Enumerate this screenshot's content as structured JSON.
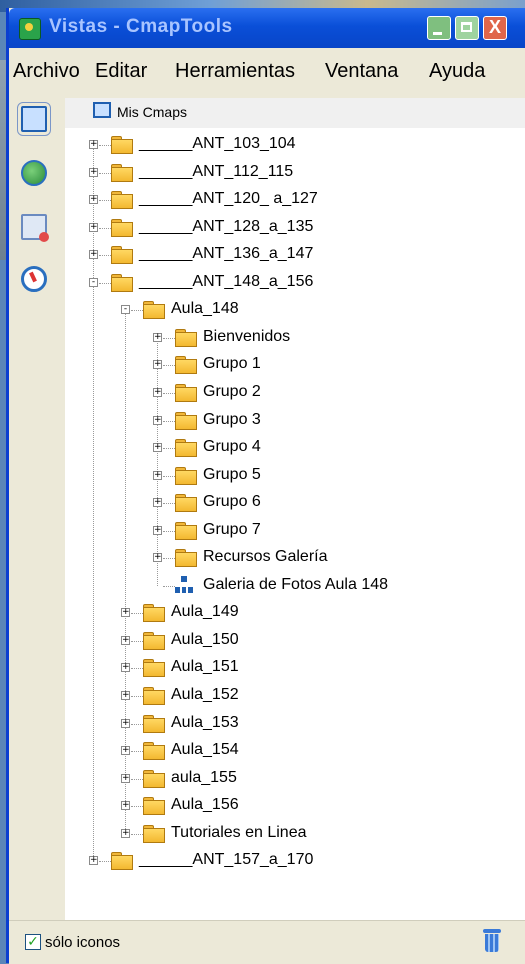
{
  "window": {
    "title": "Vistas - CmapTools",
    "close_glyph": "X"
  },
  "menu": [
    "Archivo",
    "Editar",
    "Herramientas",
    "Ventana",
    "Ayuda"
  ],
  "sidebar": [
    "monitor-icon",
    "globe-icon",
    "history-icon",
    "compass-icon"
  ],
  "tree": {
    "root": "Mis Cmaps",
    "items": [
      "______ANT_103_104",
      "______ANT_112_115",
      "______ANT_120_ a_127",
      "______ANT_128_a_135",
      "______ANT_136_a_147",
      "______ANT_148_a_156",
      "Aula_148",
      "Bienvenidos",
      "Grupo 1",
      "Grupo 2",
      "Grupo 3",
      "Grupo 4",
      "Grupo 5",
      "Grupo 6",
      "Grupo 7",
      "Recursos Galería",
      "Galeria de Fotos Aula 148",
      "Aula_149",
      "Aula_150",
      "Aula_151",
      "Aula_152",
      "Aula_153",
      "Aula_154",
      "aula_155",
      "Aula_156",
      "Tutoriales en Linea",
      "______ANT_157_a_170"
    ]
  },
  "footer": {
    "checkbox_label": "sólo iconos",
    "checked": true,
    "check_glyph": "✓"
  }
}
